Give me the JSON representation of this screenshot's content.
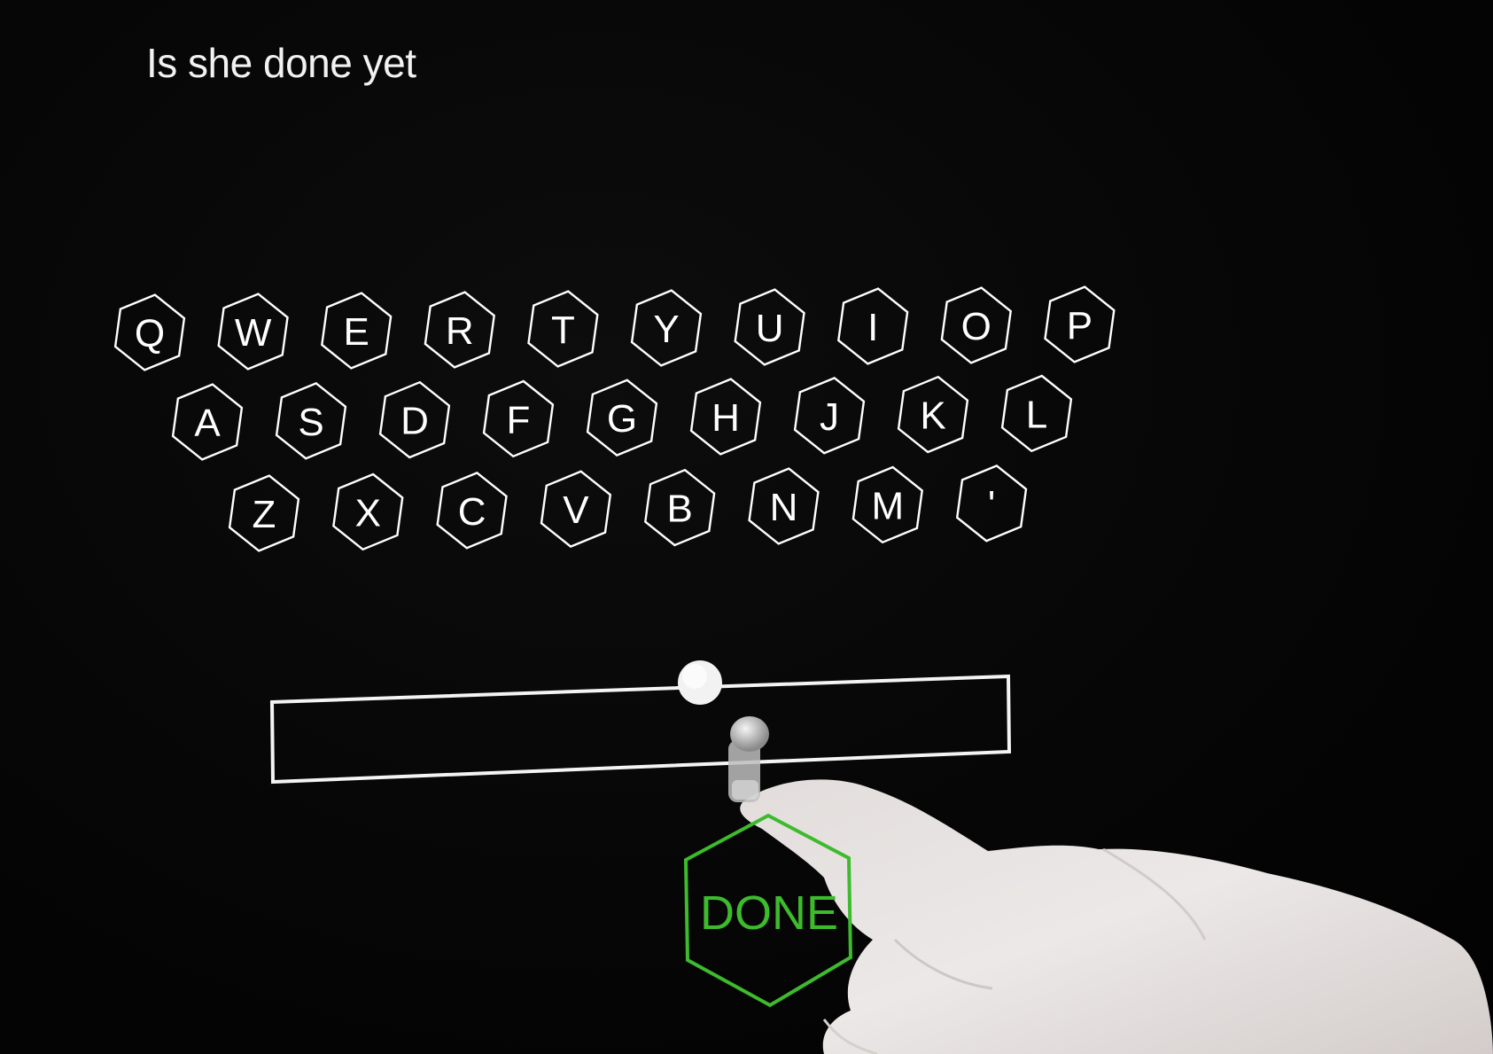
{
  "prompt": {
    "text": "Is she done yet"
  },
  "keyboard": {
    "rows": [
      [
        "Q",
        "W",
        "E",
        "R",
        "T",
        "Y",
        "U",
        "I",
        "O",
        "P"
      ],
      [
        "A",
        "S",
        "D",
        "F",
        "G",
        "H",
        "J",
        "K",
        "L"
      ],
      [
        "Z",
        "X",
        "C",
        "V",
        "B",
        "N",
        "M",
        "'"
      ]
    ],
    "key_color": "#ffffff"
  },
  "input": {
    "value": ""
  },
  "done_button": {
    "label": "DONE",
    "color": "#3dbb2d"
  },
  "cursor": {
    "icon": "fingertip-cursor-icon"
  }
}
